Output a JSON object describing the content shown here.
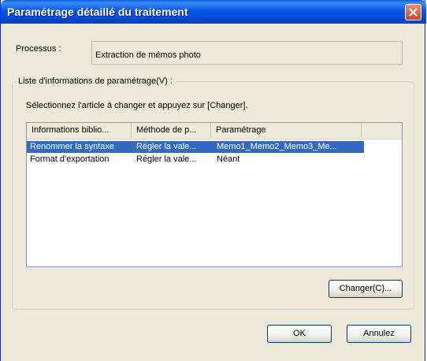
{
  "window": {
    "title": "Paramétrage détaillé du traitement"
  },
  "process": {
    "label": "Processus :",
    "value": "Extraction de mémos photo"
  },
  "group": {
    "legend": "Liste d'informations de paramétrage(V) :",
    "instruction": "Sélectionnez l'article à changer et appuyez sur [Changer]."
  },
  "list": {
    "columns": [
      "Informations biblio...",
      "Méthode de p...",
      "Paramétrage"
    ],
    "rows": [
      {
        "col1": "Renommer la syntaxe",
        "col2": "Régler la vale...",
        "col3": "Memo1_Memo2_Memo3_Me...",
        "selected": true
      },
      {
        "col1": "Format d'exportation",
        "col2": "Régler la vale...",
        "col3": "Néant",
        "selected": false
      }
    ]
  },
  "buttons": {
    "change": "Changer(C)...",
    "ok": "OK",
    "cancel": "Annulez"
  },
  "colors": {
    "selection": "#316ac5",
    "titlebar": "#0054e3",
    "dialog_bg": "#ece9d8"
  }
}
